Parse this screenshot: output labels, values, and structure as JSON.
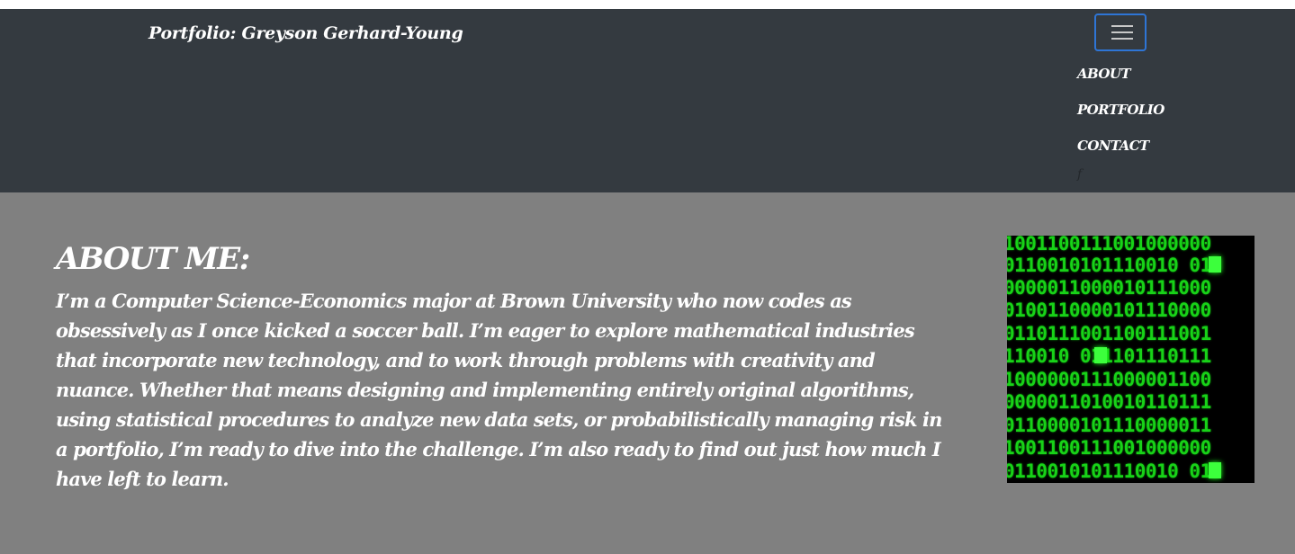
{
  "navbar": {
    "brand": "Portfolio: Greyson Gerhard-Young",
    "toggle_icon": "hamburger-menu-icon",
    "links": [
      "ABOUT",
      "PORTFOLIO",
      "CONTACT"
    ],
    "social_icon": "facebook-icon",
    "social_glyph": "f"
  },
  "about": {
    "heading": "ABOUT ME:",
    "body": "I’m a Computer Science-Economics major at Brown University who now codes as obsessively as I once kicked a soccer ball. I’m eager to explore mathematical industries that incorporate new technology, and to work through problems with creativity and nuance. Whether that means designing and implementing entirely original algorithms, using statistical procedures to analyze new data sets, or probabilistically managing risk in a portfolio, I’m ready to dive into the challenge. I’m also ready to find out just how much I have left to learn."
  },
  "image": {
    "subject": "green-binary-code-matrix-image",
    "rows": [
      "1001100111001000000",
      "0110010101110010 01",
      "0000011000010111000",
      "0100110000101110000",
      "0110111001100111001",
      "110010 011101110111",
      "1000000111000001100",
      "0000011010010110111",
      "0110000101110000011",
      "1001100111001000000",
      "0110010101110010 01"
    ]
  },
  "colors": {
    "navbar_bg": "#343a40",
    "page_bg": "#808080",
    "toggle_border": "#2e75d6",
    "matrix_green": "#18d218"
  }
}
